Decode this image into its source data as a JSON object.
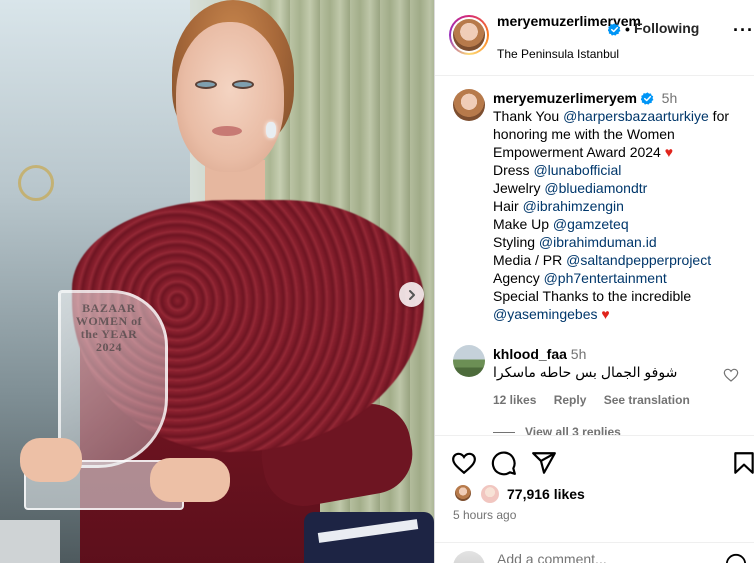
{
  "photo": {
    "trophy_text": "BAZAAR WOMEN of the YEAR 2024"
  },
  "header": {
    "username": "meryemuzerlimeryem",
    "separator": "•",
    "follow_label": "Following",
    "more_label": "···",
    "location": "The Peninsula Istanbul"
  },
  "caption": {
    "username": "meryemuzerlimeryem",
    "time": "5h",
    "lines": [
      {
        "pre": "Thank You ",
        "mention": "@harpersbazaarturkiye",
        "post": " for"
      },
      {
        "pre": "honoring me with the Women",
        "mention": "",
        "post": ""
      },
      {
        "pre": "Empowerment Award 2024 ",
        "mention": "",
        "post": "♥"
      },
      {
        "pre": "Dress ",
        "mention": "@lunabofficial",
        "post": ""
      },
      {
        "pre": "Jewelry ",
        "mention": "@bluediamondtr",
        "post": ""
      },
      {
        "pre": "Hair ",
        "mention": "@ibrahimzengin",
        "post": ""
      },
      {
        "pre": "Make Up ",
        "mention": "@gamzeteq",
        "post": ""
      },
      {
        "pre": "Styling ",
        "mention": "@ibrahimduman.id",
        "post": ""
      },
      {
        "pre": "Media / PR ",
        "mention": "@saltandpepperproject",
        "post": ""
      },
      {
        "pre": "Agency ",
        "mention": "@ph7entertainment",
        "post": ""
      },
      {
        "pre": "Special Thanks to the incredible",
        "mention": "",
        "post": ""
      },
      {
        "pre": "",
        "mention": "@yasemingebes",
        "post": " ♥"
      }
    ]
  },
  "comment": {
    "username": "khlood_faa",
    "time": "5h",
    "text": "شوفو الجمال بس حاطه ماسكرا",
    "likes": "12 likes",
    "reply_label": "Reply",
    "translate_label": "See translation",
    "view_replies": "View all 3 replies"
  },
  "actions": {
    "likes_count": "77,916 likes",
    "posted": "5 hours ago",
    "add_comment_placeholder": "Add a comment..."
  },
  "colors": {
    "mention": "#00376b",
    "verified": "#0095f6",
    "heart": "#e0241c",
    "muted": "#737373"
  },
  "icons": [
    "chevron-right-icon",
    "verified-badge-icon",
    "heart-icon",
    "comment-icon",
    "share-icon",
    "bookmark-icon",
    "emoji-icon"
  ]
}
